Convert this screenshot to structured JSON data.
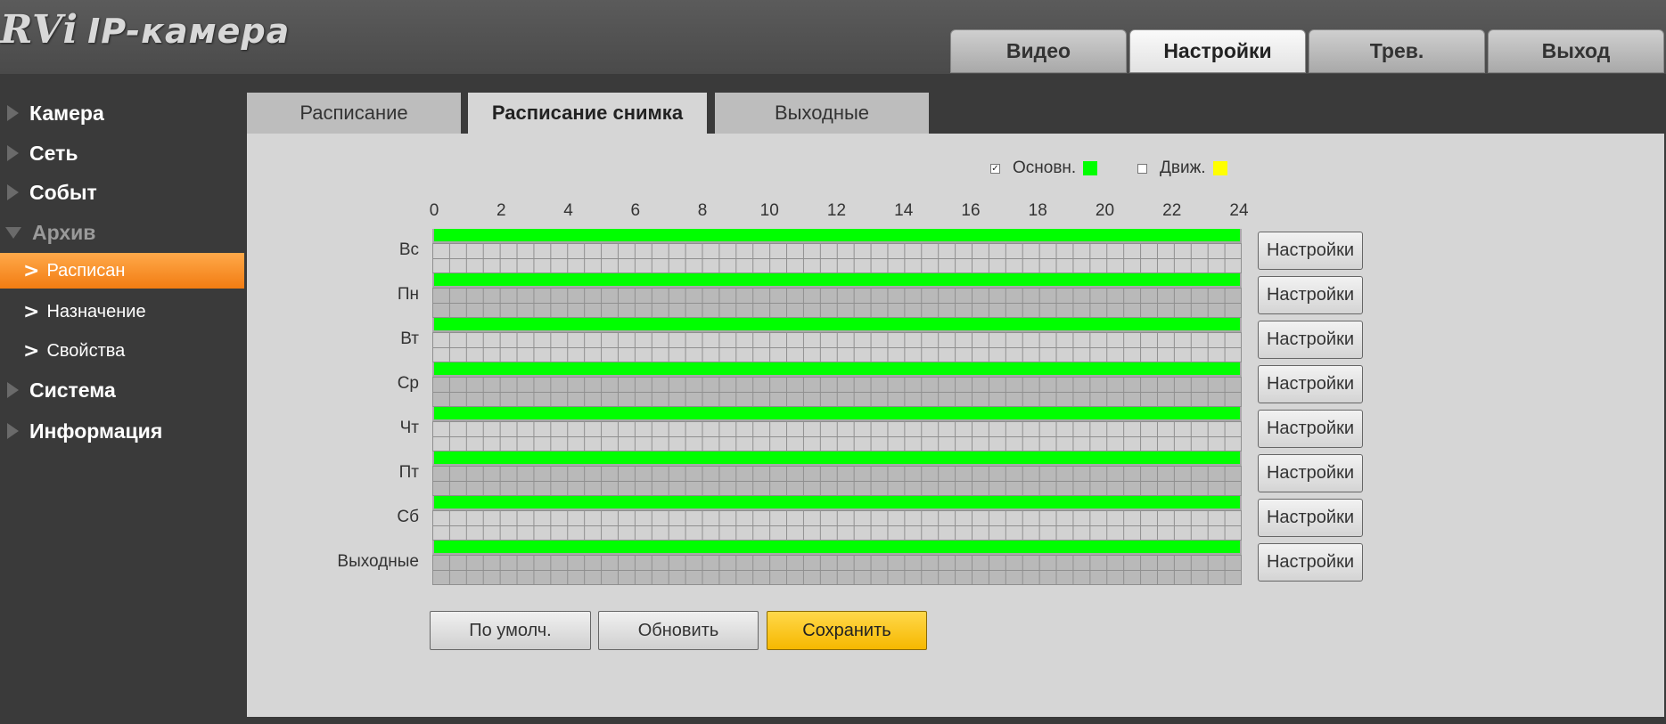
{
  "logo": {
    "brand": "RVi",
    "title": "IP-камера"
  },
  "top_tabs": [
    "Видео",
    "Настройки",
    "Трев.",
    "Выход"
  ],
  "sidebar": {
    "camera": "Камера",
    "network": "Сеть",
    "events": "Событ",
    "archive": "Архив",
    "archive_items": [
      "Расписан",
      "Назначение",
      "Свойства"
    ],
    "system": "Система",
    "info": "Информация"
  },
  "sub_tabs": [
    "Расписание",
    "Расписание снимка",
    "Выходные"
  ],
  "legend": {
    "main_label": "Основн.",
    "main_checked": "✓",
    "main_color": "#00ff00",
    "motion_label": "Движ.",
    "motion_color": "#ffff00"
  },
  "hours": [
    "0",
    "2",
    "4",
    "6",
    "8",
    "10",
    "12",
    "14",
    "16",
    "18",
    "20",
    "22",
    "24"
  ],
  "days": [
    "Вс",
    "Пн",
    "Вт",
    "Ср",
    "Чт",
    "Пт",
    "Сб",
    "Выходные"
  ],
  "row_button_label": "Настройки",
  "buttons": {
    "default": "По умолч.",
    "refresh": "Обновить",
    "save": "Сохранить"
  }
}
